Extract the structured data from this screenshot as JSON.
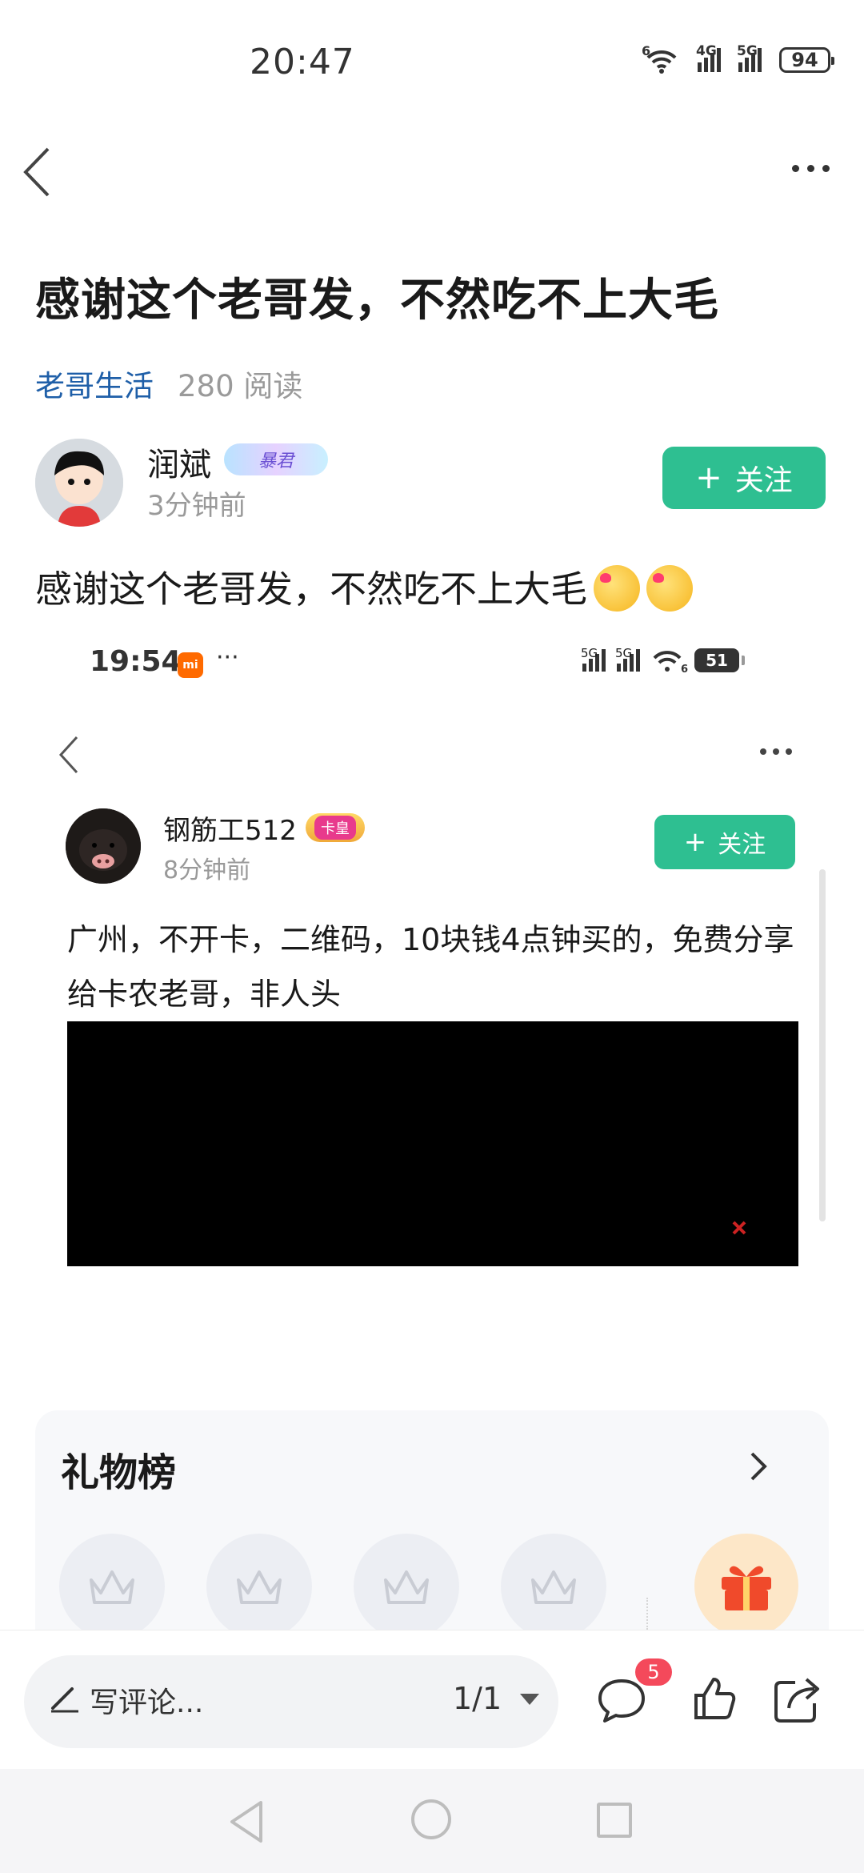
{
  "status_bar": {
    "time": "20:47",
    "wifi_label": "6",
    "signal1_label": "4G",
    "signal2_label": "5G",
    "battery": "94"
  },
  "header": {
    "back_icon": "chevron-left-icon",
    "more_icon": "more-horizontal-icon"
  },
  "post": {
    "title": "感谢这个老哥发，不然吃不上大毛",
    "circle": "老哥生活",
    "reads": "280 阅读",
    "author": {
      "name": "润斌",
      "badge": "暴君",
      "time": "3分钟前"
    },
    "follow_label": "关注",
    "body_text": "感谢这个老哥发，不然吃不上大毛"
  },
  "embedded_screenshot": {
    "time": "19:54",
    "mi_label": "mi",
    "dots": "···",
    "sig1": "5G",
    "sig2": "5G",
    "wifi": "6",
    "battery": "51",
    "author_name": "钢筋工512",
    "badge": "卡皇",
    "time_ago": "8分钟前",
    "follow_label": "关注",
    "text": "广州，不开卡，二维码，10块钱4点钟买的，免费分享给卡农老哥，非人头"
  },
  "gift_board": {
    "title": "礼物榜",
    "slots": 4
  },
  "bottom_bar": {
    "comment_placeholder": "写评论...",
    "pager": "1/1",
    "comment_count": "5"
  }
}
